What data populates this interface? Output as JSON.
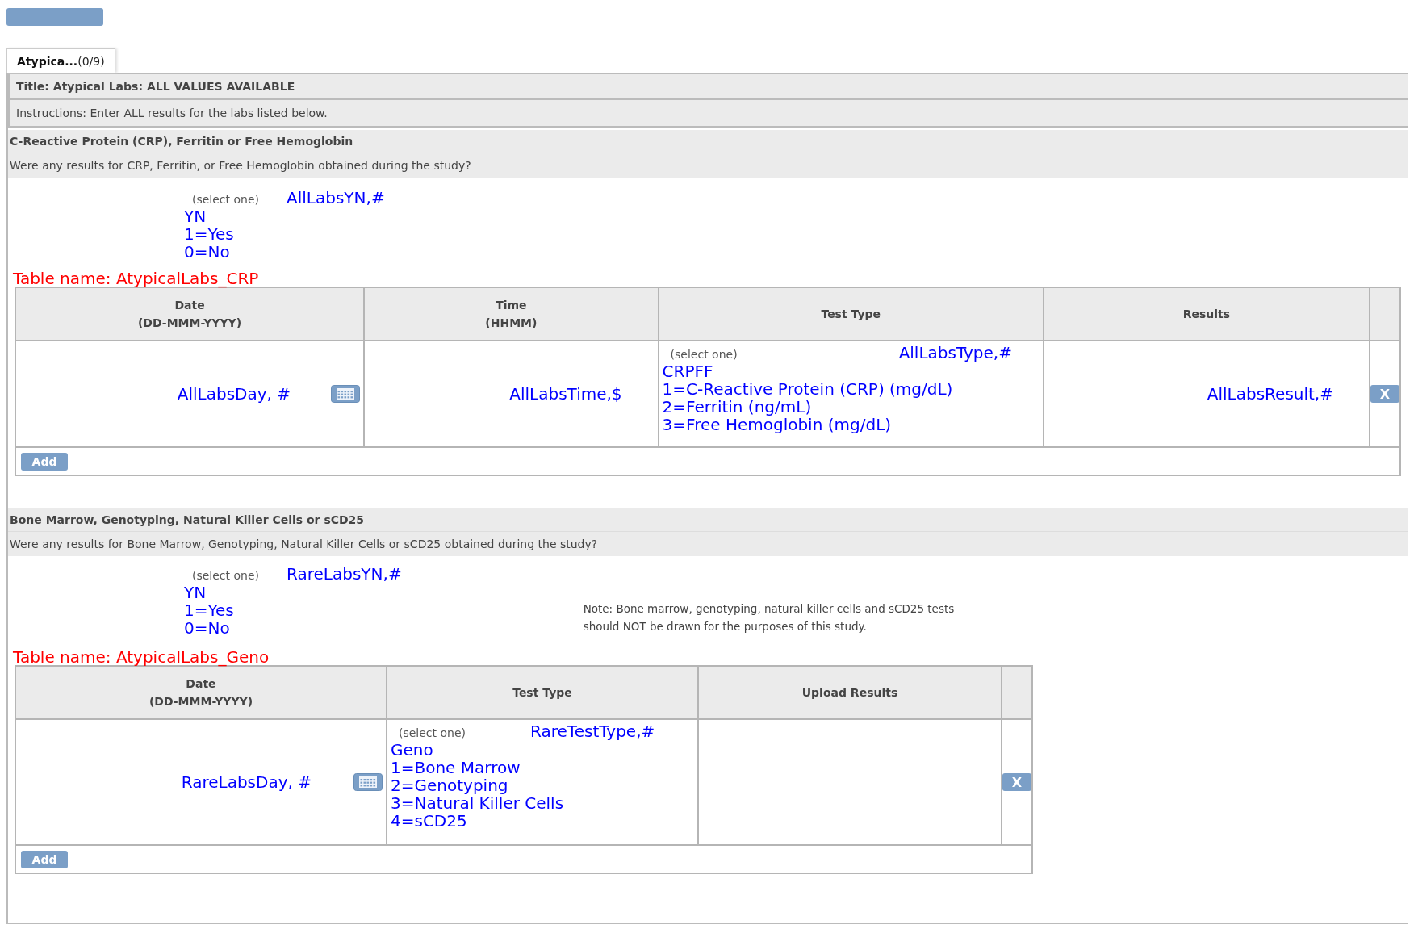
{
  "tabs": [
    {
      "label": "**Atypica...**(0/9)",
      "selected": true
    }
  ],
  "form": {
    "title": "Title: Atypical Labs: ALL VALUES AVAILABLE",
    "instructions": "Instructions: Enter ALL results for the labs listed below."
  },
  "sections": [
    {
      "heading": "C-Reactive Protein (CRP), Ferritin or Free Hemoglobin",
      "question": "Were any results for CRP, Ferritin, or Free Hemoglobin obtained during the study?",
      "select": {
        "hint": "(select one)",
        "field": "AllLabsYN,#",
        "options": [
          "YN",
          "1=Yes",
          "0=No"
        ]
      },
      "table_name": "Table name: AtypicalLabs_CRP",
      "table": {
        "columns": [
          {
            "label": "Date",
            "sub": "(DD-MMM-YYYY)"
          },
          {
            "label": "Time",
            "sub": "(HHMM)"
          },
          {
            "label": "Test Type"
          },
          {
            "label": "Results"
          },
          {}
        ],
        "rows": [
          [
            {
              "kind": "date",
              "text": "AllLabsDay, #"
            },
            {
              "kind": "text",
              "text": "AllLabsTime,$"
            },
            {
              "kind": "select",
              "hint": "(select one)",
              "field": "AllLabsType,#",
              "options": [
                "CRPFF",
                "1=C-Reactive Protein (CRP) (mg/dL)",
                "2=Ferritin (ng/mL)",
                "3=Free Hemoglobin (mg/dL)"
              ]
            },
            {
              "kind": "text",
              "text": "AllLabsResult,#"
            },
            {
              "kind": "delete",
              "text": "X"
            }
          ]
        ],
        "add": "Add"
      }
    },
    {
      "heading": "Bone Marrow, Genotyping, Natural Killer Cells or sCD25",
      "question": "Were any results for Bone Marrow, Genotyping, Natural Killer Cells or sCD25 obtained during the study?",
      "select": {
        "hint": "(select one)",
        "field": "RareLabsYN,#",
        "options": [
          "YN",
          "1=Yes",
          "0=No"
        ]
      },
      "note": "Note: Bone marrow, genotyping, natural killer cells and sCD25 tests should NOT be drawn for the purposes of this study.",
      "table_name": "Table name: AtypicalLabs_Geno",
      "table": {
        "columns": [
          {
            "label": "Date",
            "sub": "(DD-MMM-YYYY)"
          },
          {
            "label": "Test Type"
          },
          {
            "label": "Upload Results"
          },
          {}
        ],
        "rows": [
          [
            {
              "kind": "date",
              "text": "RareLabsDay, #"
            },
            {
              "kind": "select",
              "hint": "(select one)",
              "field": "RareTestType,#",
              "options": [
                "Geno",
                "1=Bone Marrow",
                "2=Genotyping",
                "3=Natural Killer Cells",
                "4=sCD25"
              ]
            },
            {
              "kind": "empty"
            },
            {
              "kind": "delete",
              "text": "X"
            }
          ]
        ],
        "add": "Add"
      }
    }
  ]
}
